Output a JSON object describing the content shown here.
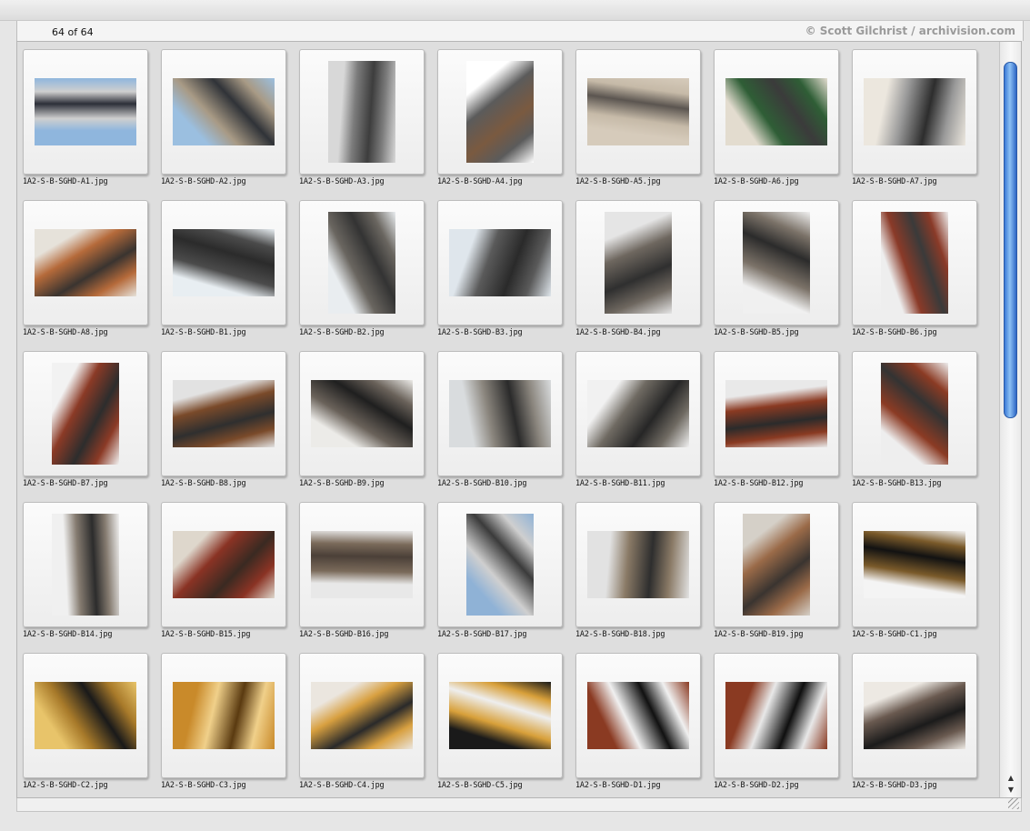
{
  "header": {
    "count_text": "64 of 64",
    "copyright": "© Scott Gilchrist / archivision.com"
  },
  "scrollbar": {
    "up_icon": "▲",
    "down_icon": "▼"
  },
  "colors": {
    "scroll_thumb": "#3a79d6",
    "background": "#dedede"
  },
  "items": [
    {
      "filename": "1A2-S-B-SGHD-A1.jpg",
      "orientation": "landscape",
      "palette": [
        "#8fb6dd",
        "#2c2f38",
        "#cfcfcf"
      ]
    },
    {
      "filename": "1A2-S-B-SGHD-A2.jpg",
      "orientation": "landscape",
      "palette": [
        "#9bbfe0",
        "#303338",
        "#a89a85"
      ]
    },
    {
      "filename": "1A2-S-B-SGHD-A3.jpg",
      "orientation": "portrait",
      "palette": [
        "#d8d8d8",
        "#3d3d3d",
        "#7c7c7c"
      ]
    },
    {
      "filename": "1A2-S-B-SGHD-A4.jpg",
      "orientation": "portrait",
      "palette": [
        "#ffffff",
        "#7a5a40",
        "#5b5b5b"
      ]
    },
    {
      "filename": "1A2-S-B-SGHD-A5.jpg",
      "orientation": "landscape",
      "palette": [
        "#d6cbbb",
        "#5b5550",
        "#c6baa8"
      ]
    },
    {
      "filename": "1A2-S-B-SGHD-A6.jpg",
      "orientation": "landscape",
      "palette": [
        "#e3dccf",
        "#3b3b3b",
        "#2f5e36"
      ]
    },
    {
      "filename": "1A2-S-B-SGHD-A7.jpg",
      "orientation": "landscape",
      "palette": [
        "#ece7de",
        "#2d2d2d",
        "#9a9a9a"
      ]
    },
    {
      "filename": "1A2-S-B-SGHD-A8.jpg",
      "orientation": "landscape",
      "palette": [
        "#e6e2da",
        "#3a3430",
        "#b56a3a"
      ]
    },
    {
      "filename": "1A2-S-B-SGHD-B1.jpg",
      "orientation": "landscape",
      "palette": [
        "#e8eef2",
        "#2b2b2b",
        "#4b4b4b"
      ]
    },
    {
      "filename": "1A2-S-B-SGHD-B2.jpg",
      "orientation": "portrait",
      "palette": [
        "#e9edf0",
        "#333333",
        "#6a6660"
      ]
    },
    {
      "filename": "1A2-S-B-SGHD-B3.jpg",
      "orientation": "landscape",
      "palette": [
        "#dfe6ec",
        "#2a2a2a",
        "#5a5a5a"
      ]
    },
    {
      "filename": "1A2-S-B-SGHD-B4.jpg",
      "orientation": "portrait",
      "palette": [
        "#e5e5e5",
        "#2f2f2f",
        "#6e675f"
      ]
    },
    {
      "filename": "1A2-S-B-SGHD-B5.jpg",
      "orientation": "portrait",
      "palette": [
        "#f0f0f0",
        "#2b2b2b",
        "#7b7268"
      ]
    },
    {
      "filename": "1A2-S-B-SGHD-B6.jpg",
      "orientation": "portrait",
      "palette": [
        "#eeeeee",
        "#3a3a3a",
        "#8a3a28"
      ]
    },
    {
      "filename": "1A2-S-B-SGHD-B7.jpg",
      "orientation": "portrait",
      "palette": [
        "#f2f2f2",
        "#2d2d2d",
        "#8b3a26"
      ]
    },
    {
      "filename": "1A2-S-B-SGHD-B8.jpg",
      "orientation": "landscape",
      "palette": [
        "#e2e2e2",
        "#2f2f2f",
        "#7a4a2a"
      ]
    },
    {
      "filename": "1A2-S-B-SGHD-B9.jpg",
      "orientation": "landscape",
      "palette": [
        "#ecebe8",
        "#1f1f1f",
        "#6a625a"
      ]
    },
    {
      "filename": "1A2-S-B-SGHD-B10.jpg",
      "orientation": "landscape",
      "palette": [
        "#d9dcde",
        "#2a2a2a",
        "#8a857d"
      ]
    },
    {
      "filename": "1A2-S-B-SGHD-B11.jpg",
      "orientation": "landscape",
      "palette": [
        "#f1f1f1",
        "#262626",
        "#6f6a62"
      ]
    },
    {
      "filename": "1A2-S-B-SGHD-B12.jpg",
      "orientation": "landscape",
      "palette": [
        "#e9e9e9",
        "#2b2b2b",
        "#8a3a22"
      ]
    },
    {
      "filename": "1A2-S-B-SGHD-B13.jpg",
      "orientation": "portrait",
      "palette": [
        "#eeeeee",
        "#333333",
        "#8b3b24"
      ]
    },
    {
      "filename": "1A2-S-B-SGHD-B14.jpg",
      "orientation": "portrait",
      "palette": [
        "#f0f0f0",
        "#2c2c2c",
        "#857b70"
      ]
    },
    {
      "filename": "1A2-S-B-SGHD-B15.jpg",
      "orientation": "landscape",
      "palette": [
        "#ded7cc",
        "#3a2a22",
        "#8a3324"
      ]
    },
    {
      "filename": "1A2-S-B-SGHD-B16.jpg",
      "orientation": "landscape",
      "palette": [
        "#e8e8e8",
        "#4b4038",
        "#7a6a5a"
      ]
    },
    {
      "filename": "1A2-S-B-SGHD-B17.jpg",
      "orientation": "portrait",
      "palette": [
        "#8fb2d6",
        "#3b3b3b",
        "#cfcfcf"
      ]
    },
    {
      "filename": "1A2-S-B-SGHD-B18.jpg",
      "orientation": "landscape",
      "palette": [
        "#e2e2e2",
        "#2e2e2e",
        "#8a7a66"
      ]
    },
    {
      "filename": "1A2-S-B-SGHD-B19.jpg",
      "orientation": "portrait",
      "palette": [
        "#d5d0c8",
        "#3a3430",
        "#9a6a48"
      ]
    },
    {
      "filename": "1A2-S-B-SGHD-C1.jpg",
      "orientation": "landscape",
      "palette": [
        "#f4f4f4",
        "#121212",
        "#7a5a2a"
      ]
    },
    {
      "filename": "1A2-S-B-SGHD-C2.jpg",
      "orientation": "landscape",
      "palette": [
        "#e8c46a",
        "#1a1a1a",
        "#a87a2a"
      ]
    },
    {
      "filename": "1A2-S-B-SGHD-C3.jpg",
      "orientation": "landscape",
      "palette": [
        "#c98a2a",
        "#5a3a10",
        "#f0d08a"
      ]
    },
    {
      "filename": "1A2-S-B-SGHD-C4.jpg",
      "orientation": "landscape",
      "palette": [
        "#ebe6df",
        "#2a2a2a",
        "#d8a040"
      ]
    },
    {
      "filename": "1A2-S-B-SGHD-C5.jpg",
      "orientation": "landscape",
      "palette": [
        "#1a1a1a",
        "#eeeeee",
        "#d8a03a"
      ]
    },
    {
      "filename": "1A2-S-B-SGHD-D1.jpg",
      "orientation": "landscape",
      "palette": [
        "#8a3a22",
        "#111111",
        "#f0f0f0"
      ]
    },
    {
      "filename": "1A2-S-B-SGHD-D2.jpg",
      "orientation": "landscape",
      "palette": [
        "#8a3a22",
        "#0f0f0f",
        "#e8e8e8"
      ]
    },
    {
      "filename": "1A2-S-B-SGHD-D3.jpg",
      "orientation": "landscape",
      "palette": [
        "#ede9e3",
        "#1b1b1b",
        "#6a5a50"
      ]
    }
  ]
}
